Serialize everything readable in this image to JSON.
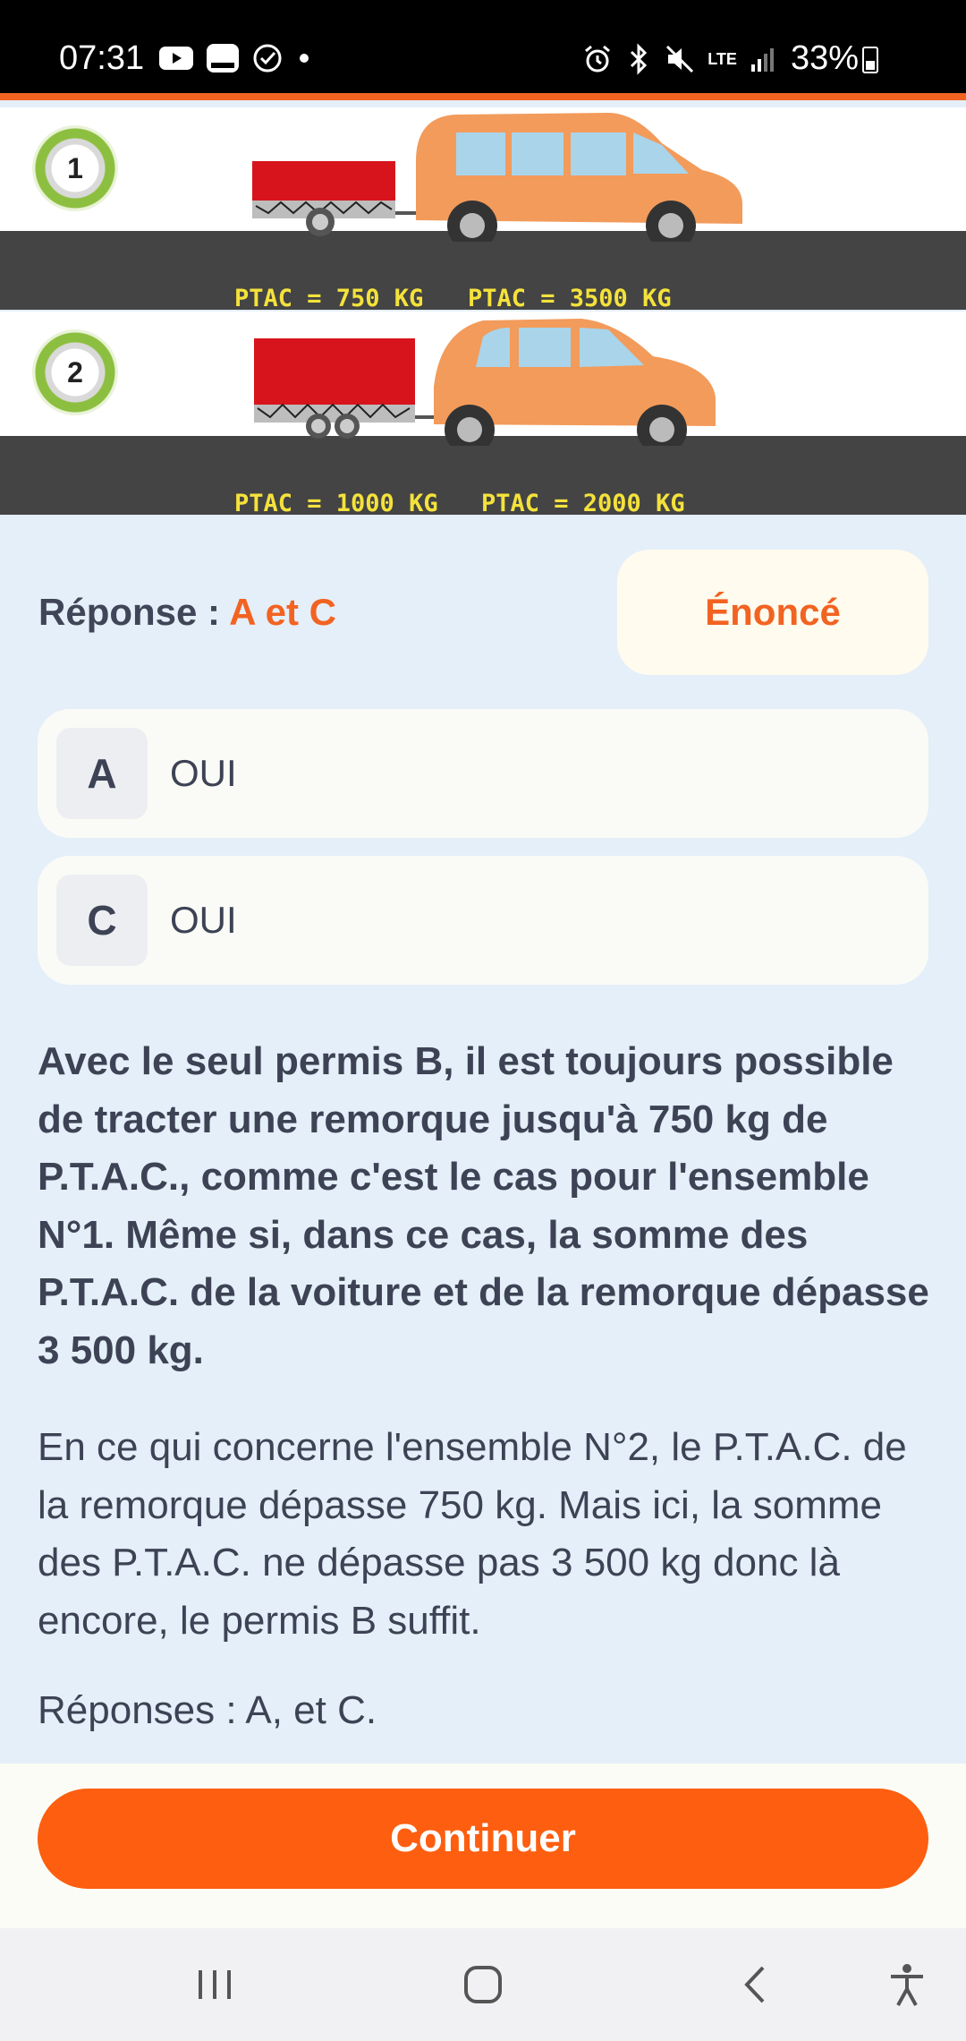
{
  "status_bar": {
    "time": "07:31",
    "battery": "33%",
    "left_icons": [
      "youtube-icon",
      "message-icon",
      "check-circle-icon",
      "dot-icon"
    ],
    "right_icons": [
      "alarm-icon",
      "bluetooth-icon",
      "mute-icon",
      "lte-icon",
      "signal-icon",
      "battery-icon"
    ],
    "network": "LTE"
  },
  "illustration": {
    "scene1": {
      "number": "1",
      "trailer_ptac": "PTAC = 750 KG",
      "car_ptac": "PTAC = 3500 KG"
    },
    "scene2": {
      "number": "2",
      "trailer_ptac": "PTAC = 1000 KG",
      "car_ptac": "PTAC = 2000 KG"
    }
  },
  "answer": {
    "label": "Réponse : ",
    "value": "A et C",
    "enonce_label": "Énoncé"
  },
  "options": [
    {
      "letter": "A",
      "text": "OUI"
    },
    {
      "letter": "C",
      "text": "OUI"
    }
  ],
  "explanation": {
    "bold": "Avec le seul permis B, il est toujours possible de tracter une remorque jusqu'à 750 kg de P.T.A.C., comme c'est le cas pour l'ensemble N°1. Même si, dans ce cas, la somme des P.T.A.C. de la voiture et de la remorque dépasse 3 500 kg.",
    "normal": "En ce qui concerne l'ensemble N°2, le P.T.A.C. de la remorque dépasse 750 kg. Mais ici, la somme des P.T.A.C. ne dépasse pas 3 500 kg donc là encore, le permis B suffit.",
    "responses": "Réponses : A, et C."
  },
  "continue_label": "Continuer",
  "nav": [
    "recent-apps-icon",
    "home-icon",
    "back-icon",
    "accessibility-icon"
  ],
  "colors": {
    "accent": "#f26322",
    "button": "#fd5e0f",
    "background": "#e4eff9",
    "car": "#f29b5b",
    "trailer": "#d7141c",
    "ptac_text": "#f4e23b"
  }
}
